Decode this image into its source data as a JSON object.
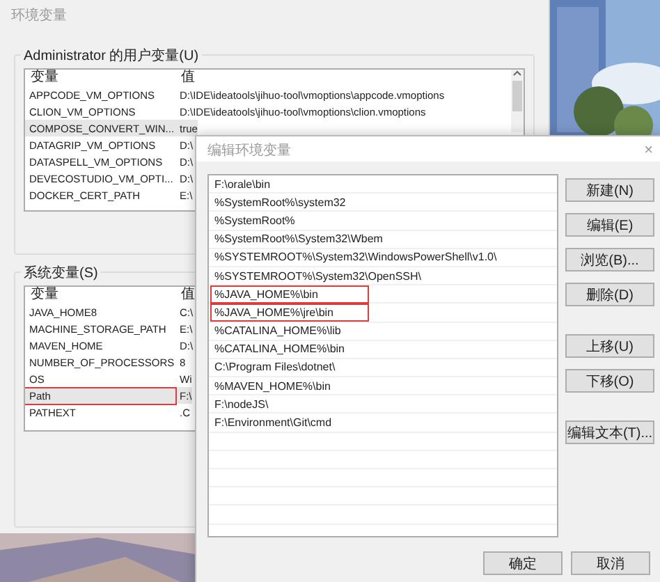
{
  "back_window": {
    "title": "环境变量",
    "user_vars": {
      "label": "Administrator 的用户变量(U)",
      "columns": [
        "变量",
        "值"
      ],
      "rows": [
        {
          "name": "APPCODE_VM_OPTIONS",
          "value": "D:\\IDE\\ideatools\\jihuo-tool\\vmoptions\\appcode.vmoptions",
          "selected": false
        },
        {
          "name": "CLION_VM_OPTIONS",
          "value": "D:\\IDE\\ideatools\\jihuo-tool\\vmoptions\\clion.vmoptions",
          "selected": false
        },
        {
          "name": "COMPOSE_CONVERT_WIN...",
          "value": "true",
          "selected": true
        },
        {
          "name": "DATAGRIP_VM_OPTIONS",
          "value": "D:\\",
          "selected": false
        },
        {
          "name": "DATASPELL_VM_OPTIONS",
          "value": "D:\\",
          "selected": false
        },
        {
          "name": "DEVECOSTUDIO_VM_OPTI...",
          "value": "D:\\",
          "selected": false
        },
        {
          "name": "DOCKER_CERT_PATH",
          "value": "E:\\",
          "selected": false
        }
      ]
    },
    "system_vars": {
      "label": "系统变量(S)",
      "columns": [
        "变量",
        "值"
      ],
      "rows": [
        {
          "name": "JAVA_HOME8",
          "value": "C:\\",
          "selected": false,
          "highlighted": false
        },
        {
          "name": "MACHINE_STORAGE_PATH",
          "value": "E:\\",
          "selected": false,
          "highlighted": false
        },
        {
          "name": "MAVEN_HOME",
          "value": "D:\\",
          "selected": false,
          "highlighted": false
        },
        {
          "name": "NUMBER_OF_PROCESSORS",
          "value": "8",
          "selected": false,
          "highlighted": false
        },
        {
          "name": "OS",
          "value": "Wi",
          "selected": false,
          "highlighted": false
        },
        {
          "name": "Path",
          "value": "F:\\",
          "selected": true,
          "highlighted": true
        },
        {
          "name": "PATHEXT",
          "value": ".C",
          "selected": false,
          "highlighted": false
        }
      ]
    }
  },
  "edit_dialog": {
    "title": "编辑环境变量",
    "close": "×",
    "entries": [
      {
        "text": "F:\\orale\\bin",
        "highlighted": false
      },
      {
        "text": "%SystemRoot%\\system32",
        "highlighted": false
      },
      {
        "text": "%SystemRoot%",
        "highlighted": false
      },
      {
        "text": "%SystemRoot%\\System32\\Wbem",
        "highlighted": false
      },
      {
        "text": "%SYSTEMROOT%\\System32\\WindowsPowerShell\\v1.0\\",
        "highlighted": false
      },
      {
        "text": "%SYSTEMROOT%\\System32\\OpenSSH\\",
        "highlighted": false
      },
      {
        "text": "%JAVA_HOME%\\bin",
        "highlighted": true
      },
      {
        "text": "%JAVA_HOME%\\jre\\bin",
        "highlighted": true
      },
      {
        "text": "%CATALINA_HOME%\\lib",
        "highlighted": false
      },
      {
        "text": "%CATALINA_HOME%\\bin",
        "highlighted": false
      },
      {
        "text": "C:\\Program Files\\dotnet\\",
        "highlighted": false
      },
      {
        "text": "%MAVEN_HOME%\\bin",
        "highlighted": false
      },
      {
        "text": "F:\\nodeJS\\",
        "highlighted": false
      },
      {
        "text": "F:\\Environment\\Git\\cmd",
        "highlighted": false
      }
    ],
    "side_button_groups": [
      [
        "新建(N)",
        "编辑(E)",
        "浏览(B)...",
        "删除(D)"
      ],
      [
        "上移(U)",
        "下移(O)"
      ],
      [
        "编辑文本(T)..."
      ]
    ],
    "footer_buttons": [
      "确定",
      "取消"
    ]
  }
}
